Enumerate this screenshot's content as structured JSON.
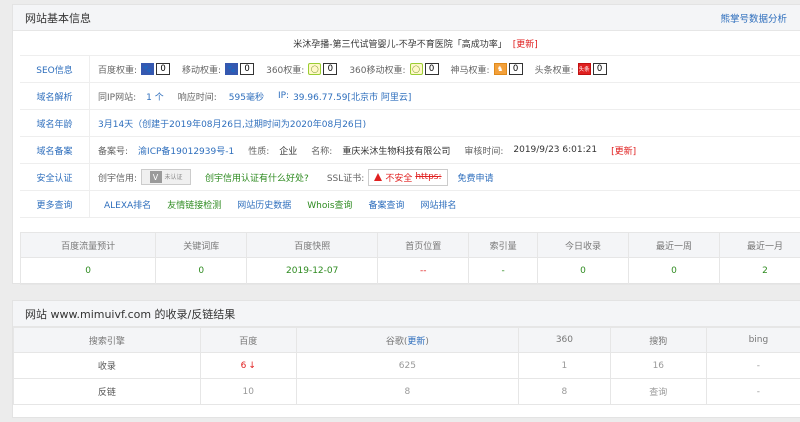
{
  "site_info": {
    "header_title": "网站基本信息",
    "header_link": "熊掌号数据分析",
    "site_title": "米沐孕播-第三代试管婴儿-不孕不育医院「高成功率」",
    "update_label": "[更新]"
  },
  "seo": {
    "label": "SEO信息",
    "items": [
      {
        "name": "百度权重:",
        "value": "0",
        "icon": "baidu-paw-icon"
      },
      {
        "name": "移动权重:",
        "value": "0",
        "icon": "baidu-paw-icon"
      },
      {
        "name": "360权重:",
        "value": "0",
        "icon": "360-icon"
      },
      {
        "name": "360移动权重:",
        "value": "0",
        "icon": "360-icon"
      },
      {
        "name": "神马权重:",
        "value": "0",
        "icon": "shenma-icon"
      },
      {
        "name": "头条权重:",
        "value": "0",
        "icon": "toutiao-icon"
      }
    ],
    "icon_text_toutiao": "头条"
  },
  "dns": {
    "label": "域名解析",
    "same_ip_label": "同IP网站:",
    "same_ip_value": "1 个",
    "response_label": "响应时间:",
    "response_value": "595毫秒",
    "ip_label": "IP:",
    "ip_value": "39.96.77.59[北京市 阿里云]"
  },
  "age": {
    "label": "域名年龄",
    "value": "3月14天（创建于2019年08月26日,过期时间为2020年08月26日)"
  },
  "icp": {
    "label": "域名备案",
    "num_label": "备案号:",
    "num_value": "渝ICP备19012939号-1",
    "nature_label": "性质:",
    "nature_value": "企业",
    "name_label": "名称:",
    "name_value": "重庆米沐生物科技有限公司",
    "time_label": "审核时间:",
    "time_value": "2019/9/23 6:01:21",
    "update_label": "[更新]"
  },
  "security": {
    "label": "安全认证",
    "credit_label": "创宇信用:",
    "credit_logo_text": "未认证",
    "credit_link": "创宇信用认证有什么好处?",
    "ssl_label": "SSL证书:",
    "ssl_status": "不安全",
    "ssl_https": "https:",
    "ssl_apply": "免费申请"
  },
  "more": {
    "label": "更多查询",
    "links": [
      "ALEXA排名",
      "友情链接检测",
      "网站历史数据",
      "Whois查询",
      "备案查询",
      "网站排名"
    ]
  },
  "stats": {
    "headers": [
      "百度流量预计",
      "关键词库",
      "百度快照",
      "首页位置",
      "索引量",
      "今日收录",
      "最近一周",
      "最近一月"
    ],
    "values": [
      "0",
      "0",
      "2019-12-07",
      "--",
      "-",
      "0",
      "0",
      "2"
    ]
  },
  "engines": {
    "header_title": "网站 www.mimuivf.com 的收录/反链结果",
    "columns": [
      "搜索引擎",
      "百度",
      "谷歌(更新)",
      "360",
      "搜狗",
      "bing"
    ],
    "google_main": "谷歌(",
    "google_update": "更新",
    "google_close": ")",
    "rows": [
      {
        "label": "收录",
        "baidu": "6",
        "google": "625",
        "so360": "1",
        "sogou": "16",
        "bing": "-"
      },
      {
        "label": "反链",
        "baidu": "10",
        "google": "8",
        "so360": "8",
        "sogou": "查询",
        "bing": "-"
      }
    ]
  }
}
